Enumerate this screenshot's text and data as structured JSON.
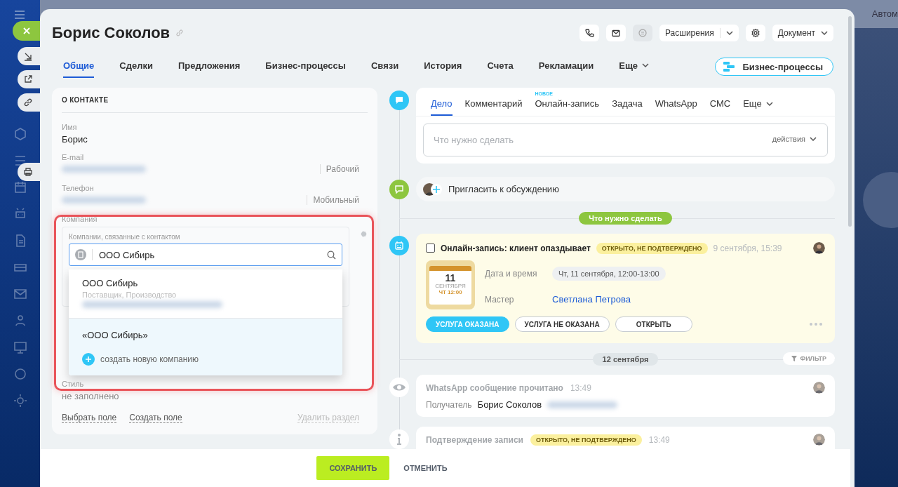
{
  "background": {
    "header_text": "Автом"
  },
  "title": "Борис Соколов",
  "header_buttons": [
    {
      "kind": "phone",
      "disabled": false
    },
    {
      "kind": "mail",
      "disabled": false
    },
    {
      "kind": "chat",
      "disabled": true
    }
  ],
  "extensions": "Расширения",
  "document": "Документ",
  "tabs": [
    {
      "label": "Общие",
      "selected": true
    },
    {
      "label": "Сделки",
      "selected": false
    },
    {
      "label": "Предложения",
      "selected": false
    },
    {
      "label": "Бизнес-процессы",
      "selected": false
    },
    {
      "label": "Связи",
      "selected": false
    },
    {
      "label": "История",
      "selected": false
    },
    {
      "label": "Счета",
      "selected": false
    },
    {
      "label": "Рекламации",
      "selected": false
    },
    {
      "label": "Еще",
      "selected": false,
      "kind": "more"
    }
  ],
  "bp_button": "Бизнес-процессы",
  "contact": {
    "section_title": "О КОНТАКТЕ",
    "fields": [
      {
        "label": "Имя",
        "value": "Борис"
      },
      {
        "label": "E-mail",
        "type_label": "Рабочий"
      },
      {
        "label": "Телефон",
        "type_label": "Мобильный"
      }
    ],
    "company": {
      "label": "Компания",
      "hint": "Компании, связанные с контактом",
      "search_value": "ООО Сибирь",
      "results": [
        {
          "name": "ООО Сибирь",
          "subtitle": "Поставщик, Производство"
        }
      ],
      "create_name": "«ООО Сибирь»",
      "create_label": "создать новую компанию"
    },
    "style_field": {
      "label": "Стиль",
      "value": "не заполнено"
    },
    "links": [
      "Выбрать поле",
      "Создать поле"
    ],
    "delete_link": "Удалить раздел"
  },
  "composer": {
    "tabs": [
      {
        "label": "Дело",
        "selected": true
      },
      {
        "label": "Комментарий",
        "selected": false
      },
      {
        "label": "Онлайн-запись",
        "selected": false,
        "badge": "НОВОЕ"
      },
      {
        "label": "Задача",
        "selected": false
      },
      {
        "label": "WhatsApp",
        "selected": false
      },
      {
        "label": "СМС",
        "selected": false
      },
      {
        "label": "Еще",
        "selected": false,
        "kind": "more"
      }
    ],
    "placeholder": "Что нужно сделать",
    "actions": "действия"
  },
  "invite": "Пригласить к обсуждению",
  "todo_divider": "Что нужно сделать",
  "booking": {
    "checked": false,
    "title": "Онлайн-запись: клиент опаздывает",
    "status": "ОТКРЫТО, НЕ ПОДТВЕРЖДЕНО",
    "time": "9 сентября, 15:39",
    "calendar": {
      "day": "11",
      "month": "СЕНТЯБРЯ",
      "weekday_time": "ЧТ 12:00"
    },
    "details": [
      {
        "label": "Дата и время",
        "value": "Чт, 11 сентября, 12:00-13:00",
        "kind": "pill"
      },
      {
        "label": "Мастер",
        "value": "Светлана Петрова",
        "kind": "link"
      }
    ],
    "buttons": [
      {
        "label": "УСЛУГА ОКАЗАНА",
        "kind": "primary"
      },
      {
        "label": "УСЛУГА НЕ ОКАЗАНА",
        "kind": "outline"
      },
      {
        "label": "ОТКРЫТЬ",
        "kind": "outline"
      }
    ]
  },
  "date_divider": "12 сентября",
  "filter": "ФИЛЬТР",
  "events": [
    {
      "kind": "read",
      "title": "WhatsApp сообщение прочитано",
      "time": "13:49",
      "recipient_label": "Получатель",
      "recipient": "Борис Соколов"
    },
    {
      "kind": "info",
      "title": "Подтверждение записи",
      "status": "ОТКРЫТО, НЕ ПОДТВЕРЖДЕНО",
      "time": "13:49"
    }
  ],
  "footer": {
    "save": "СОХРАНИТЬ",
    "cancel": "ОТМЕНИТЬ"
  }
}
